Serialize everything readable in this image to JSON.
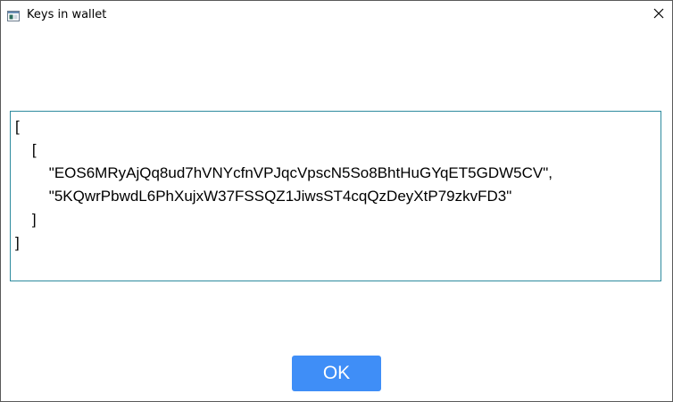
{
  "window": {
    "title": "Keys in wallet",
    "icon": "window-app-icon",
    "close_icon": "close-icon"
  },
  "keys_text": {
    "lines": [
      "[",
      "    [",
      "        \"EOS6MRyAjQq8ud7hVNYcfnVPJqcVpscN5So8BhtHuGYqET5GDW5CV\",",
      "        \"5KQwrPbwdL6PhXujxW37FSSQZ1JiwsST4cqQzDeyXtP79zkvFD3\"",
      "    ]",
      "]"
    ]
  },
  "buttons": {
    "ok_label": "OK"
  },
  "colors": {
    "ok_button": "#3f8ef7",
    "textarea_border": "#2e8b9e"
  }
}
